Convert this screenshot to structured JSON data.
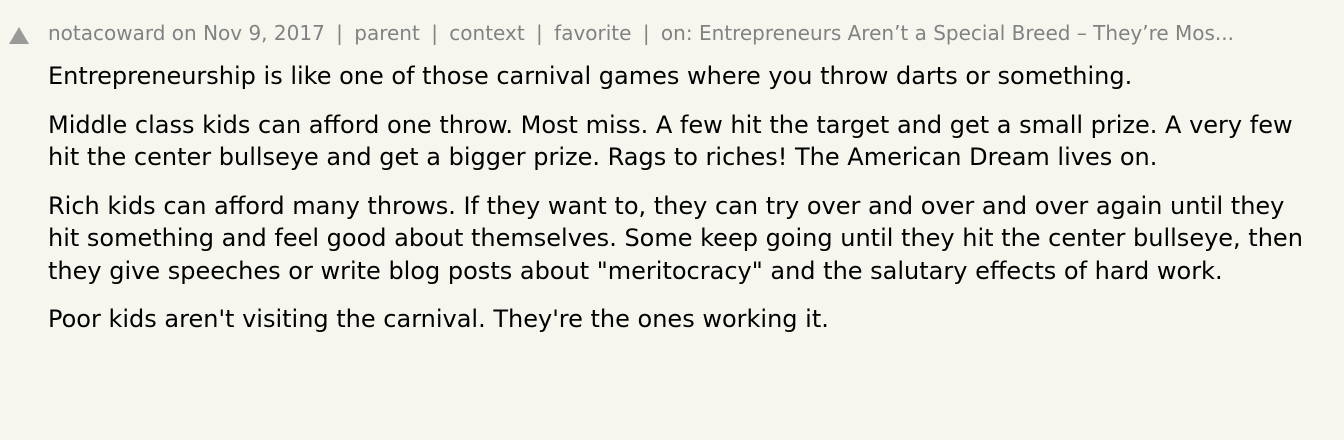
{
  "comment": {
    "user": "notacoward",
    "age_prefix": "on",
    "date": "Nov 9, 2017",
    "links": {
      "parent": "parent",
      "context": "context",
      "favorite": "favorite"
    },
    "story_prefix": "on:",
    "story_title": "Entrepreneurs Aren’t a Special Breed – They’re Mos...",
    "separator": "|",
    "paragraphs": [
      "Entrepreneurship is like one of those carnival games where you throw darts or something.",
      "Middle class kids can afford one throw. Most miss. A few hit the target and get a small prize. A very few hit the center bullseye and get a bigger prize. Rags to riches! The American Dream lives on.",
      "Rich kids can afford many throws. If they want to, they can try over and over and over again until they hit something and feel good about themselves. Some keep going until they hit the center bullseye, then they give speeches or write blog posts about \"meritocracy\" and the salutary effects of hard work.",
      "Poor kids aren't visiting the carnival. They're the ones working it."
    ]
  },
  "icons": {
    "vote": "upvote-arrow-icon"
  },
  "colors": {
    "background": "#f6f6ef",
    "meta_text": "#828282",
    "vote_arrow": "#9a9a9a",
    "body_text": "#000000"
  }
}
